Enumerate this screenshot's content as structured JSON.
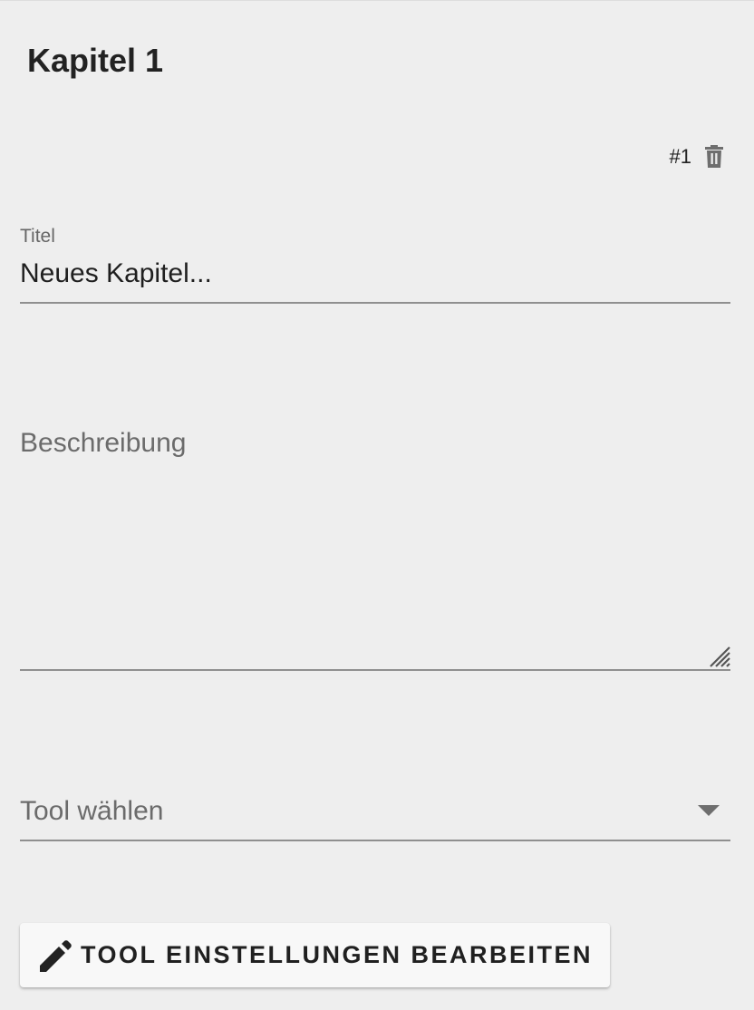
{
  "chapter": {
    "title": "Kapitel 1",
    "number": "#1",
    "delete_icon": "trash-icon"
  },
  "form": {
    "title_label": "Titel",
    "title_value": "Neues Kapitel...",
    "description_placeholder": "Beschreibung",
    "description_value": "",
    "tool_select_placeholder": "Tool wählen",
    "tool_select_icon": "chevron-down-icon"
  },
  "actions": {
    "tool_settings_label": "TOOL EINSTELLUNGEN BEARBEITEN",
    "tool_settings_icon": "pencil-icon"
  },
  "colors": {
    "background": "#eeeeee",
    "text": "#1f1f1f",
    "muted_text": "#6b6b6b",
    "underline": "#8f8f8f",
    "button_background": "#f8f8f8"
  }
}
